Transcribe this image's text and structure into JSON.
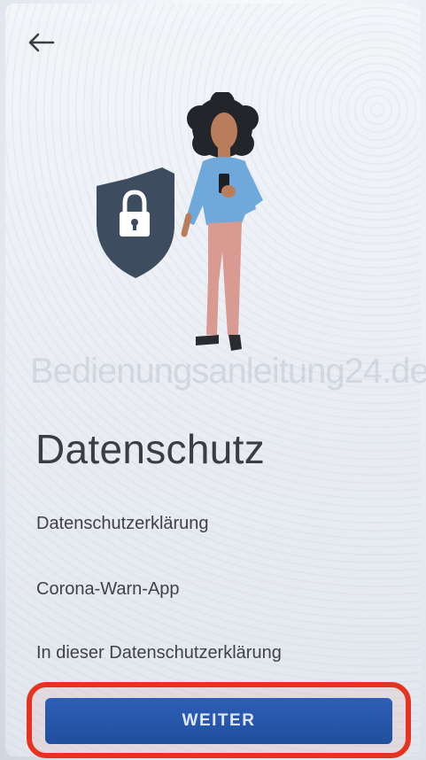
{
  "header": {
    "back_icon": "arrow-left-icon"
  },
  "illustration": {
    "shield_icon": "lock-shield-icon",
    "person": "person-holding-phone"
  },
  "watermark": "Bedienungsanleitung24.de",
  "content": {
    "title": "Datenschutz",
    "line1": "Datenschutzerklärung",
    "line2": "Corona-Warn-App",
    "line3": "In dieser Datenschutzerklärung"
  },
  "footer": {
    "button_label": "WEITER"
  },
  "colors": {
    "primary": "#2358ad",
    "highlight": "#e53320",
    "shield": "#3d4c5e",
    "shirt": "#6fa9dc",
    "pants": "#d99a92"
  }
}
